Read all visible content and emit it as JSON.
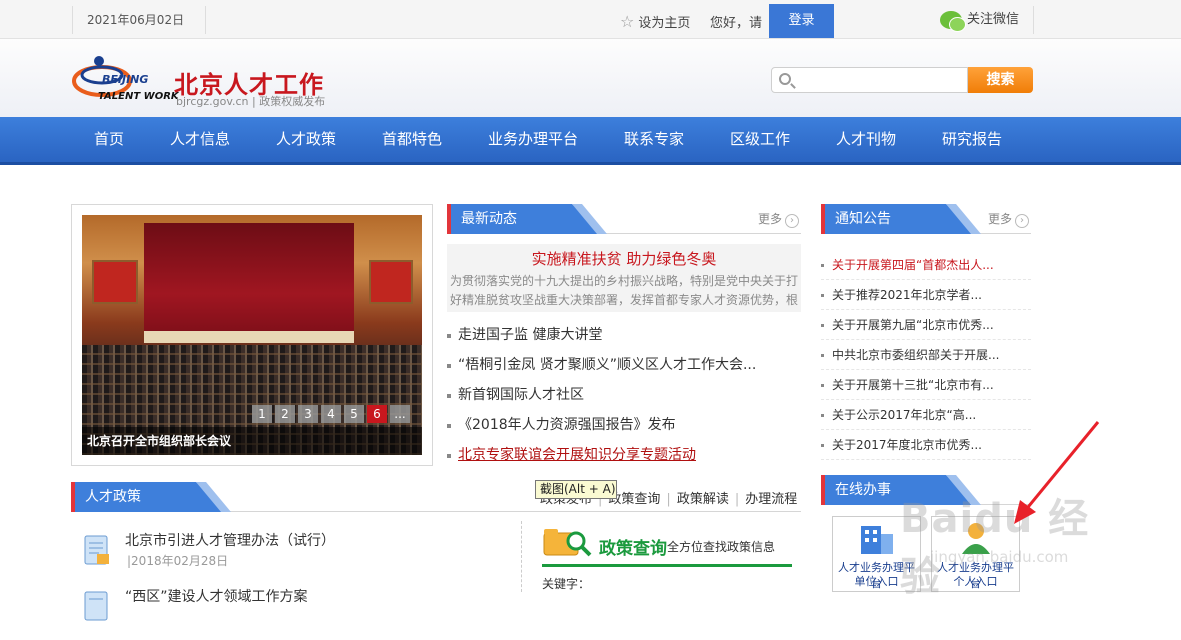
{
  "topbar": {
    "date": "2021年06月02日",
    "set_homepage": "设为主页",
    "greeting": "您好，请",
    "login": "登录",
    "wechat": "关注微信"
  },
  "header": {
    "logo_en_1": "BEIJING",
    "logo_en_2": "TALENT WORK",
    "logo_cn": "北京人才工作",
    "logo_url": "bjrcgz.gov.cn | 政策权威发布",
    "search_placeholder": "",
    "search_button": "搜索"
  },
  "nav": {
    "items": [
      "首页",
      "人才信息",
      "人才政策",
      "首都特色",
      "业务办理平台",
      "联系专家",
      "区级工作",
      "人才刊物",
      "研究报告"
    ]
  },
  "slider": {
    "pages": [
      "1",
      "2",
      "3",
      "4",
      "5",
      "6",
      "..."
    ],
    "active_page": "6",
    "caption": "北京召开全市组织部长会议"
  },
  "latest": {
    "title": "最新动态",
    "more": "更多",
    "feature_title": "实施精准扶贫 助力绿色冬奥",
    "feature_summary": "为贯彻落实党的十九大提出的乡村振兴战略，特别是党中央关于打好精准脱贫攻坚战重大决策部署，发挥首都专家人才资源优势，根",
    "items": [
      "走进国子监 健康大讲堂",
      "“梧桐引金凤 贤才聚顺义”顺义区人才工作大会...",
      "新首钢国际人才社区",
      "《2018年人力资源强国报告》发布",
      "北京专家联谊会开展知识分享专题活动"
    ]
  },
  "notice": {
    "title": "通知公告",
    "more": "更多",
    "items": [
      "关于开展第四届“首都杰出人...",
      "关于推荐2021年北京学者...",
      "关于开展第九届“北京市优秀...",
      "中共北京市委组织部关于开展...",
      "关于开展第十三批“北京市有...",
      "关于公示2017年北京“高...",
      "关于2017年度北京市优秀..."
    ]
  },
  "policy": {
    "title": "人才政策",
    "tooltip": "截图(Alt + A)",
    "tabs": [
      "政策发布",
      "政策查询",
      "政策解读",
      "办理流程"
    ],
    "items": [
      {
        "title": "北京市引进人才管理办法（试行）",
        "date": "|2018年02月28日"
      },
      {
        "title": "“西区”建设人才领域工作方案",
        "date": ""
      }
    ],
    "query_title": "政策查询",
    "query_sub": "全方位查找政策信息",
    "keyword_label": "关键字："
  },
  "online": {
    "title": "在线办事",
    "cards": [
      {
        "line1": "人才业务办理平台",
        "line2": "单位入口"
      },
      {
        "line1": "人才业务办理平台",
        "line2": "个人入口"
      }
    ]
  },
  "watermark": {
    "text": "Baidu 经验",
    "sub": "jingyan.baidu.com"
  },
  "colors": {
    "nav_blue": "#2f6fd0",
    "brand_red": "#c8171e",
    "search_orange": "#f28a12",
    "policy_green": "#1b9a3e"
  }
}
